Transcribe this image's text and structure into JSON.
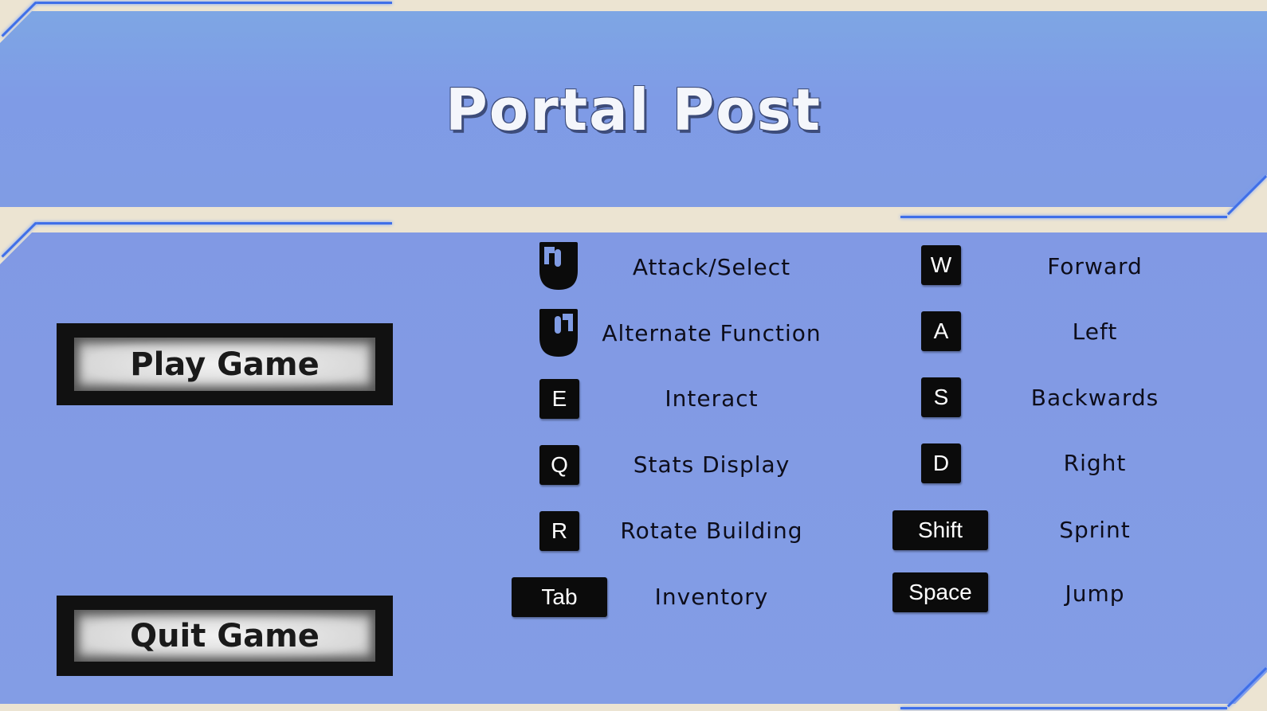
{
  "title": "Portal Post",
  "menu": {
    "play_label": "Play Game",
    "quit_label": "Quit Game"
  },
  "controls_left": [
    {
      "key": "left-mouse",
      "action": "Attack/Select"
    },
    {
      "key": "right-mouse",
      "action": "Alternate Function"
    },
    {
      "key": "E",
      "action": "Interact"
    },
    {
      "key": "Q",
      "action": "Stats Display"
    },
    {
      "key": "R",
      "action": "Rotate Building"
    },
    {
      "key": "Tab",
      "action": "Inventory"
    }
  ],
  "controls_right": [
    {
      "key": "W",
      "action": "Forward"
    },
    {
      "key": "A",
      "action": "Left"
    },
    {
      "key": "S",
      "action": "Backwards"
    },
    {
      "key": "D",
      "action": "Right"
    },
    {
      "key": "Shift",
      "action": "Sprint"
    },
    {
      "key": "Space",
      "action": "Jump"
    }
  ],
  "colors": {
    "background": "#ece4d2",
    "panel": "#809ce4",
    "edge": "#3f6fe8",
    "key": "#0b0b0b"
  }
}
